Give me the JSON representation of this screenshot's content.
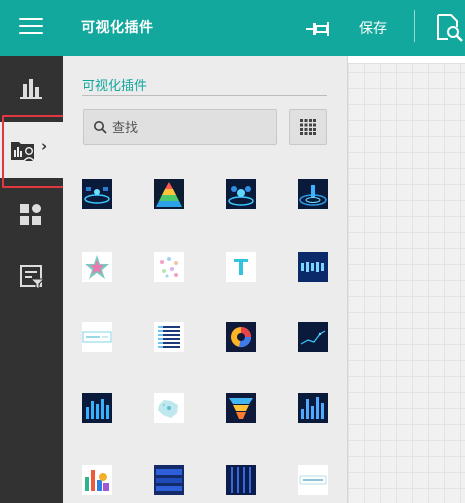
{
  "topbar": {
    "title": "可视化插件",
    "save_label": "保存",
    "icons": [
      "menu-icon",
      "pin-icon",
      "preview-icon"
    ],
    "color": "#13a89e"
  },
  "sidebar": {
    "items": [
      {
        "icon": "bar-chart-icon"
      },
      {
        "icon": "plugin-folder-icon",
        "active": true
      },
      {
        "icon": "dashboard-icon"
      },
      {
        "icon": "report-filter-icon"
      }
    ]
  },
  "panel": {
    "title": "可视化插件",
    "search_placeholder": "查找",
    "plugins": [
      "glow-stage-plugin",
      "pyramid-plugin",
      "stage-cluster-plugin",
      "radar-stage-plugin",
      "star-plugin",
      "particle-plugin",
      "text-plugin",
      "digital-number-plugin",
      "banner-plugin",
      "list-plugin",
      "donut-plugin",
      "line-dark-plugin",
      "bar-glow-plugin",
      "map-plugin",
      "funnel-plugin",
      "bar-gradient-plugin",
      "mosaic-plugin",
      "panel-plugin",
      "stripe-plugin",
      "label-plugin"
    ]
  },
  "colors": {
    "accent": "#13a89e",
    "sidebar": "#323232",
    "highlight": "#e0383e"
  }
}
